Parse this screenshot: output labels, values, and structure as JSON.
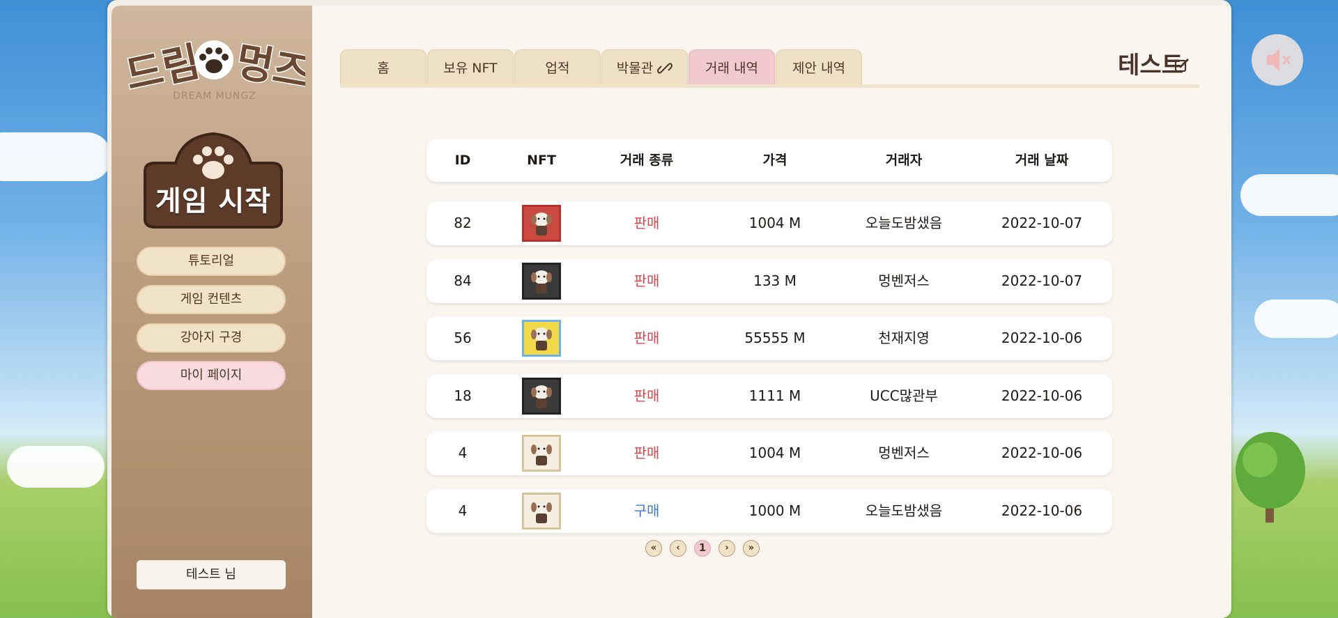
{
  "sidebar": {
    "logo_text": "드림멍즈",
    "logo_sub": "DREAM MUNGZ",
    "start_button": "게임 시작",
    "nav": [
      {
        "label": "튜토리얼"
      },
      {
        "label": "게임 컨텐츠"
      },
      {
        "label": "강아지 구경"
      },
      {
        "label": "마이 페이지"
      }
    ],
    "user_label": "테스트 님"
  },
  "tabs": [
    {
      "label": "홈"
    },
    {
      "label": "보유 NFT"
    },
    {
      "label": "업적"
    },
    {
      "label": "박물관"
    },
    {
      "label": "거래 내역"
    },
    {
      "label": "제안 내역"
    }
  ],
  "profile": {
    "name": "테스트"
  },
  "table": {
    "headers": [
      "ID",
      "NFT",
      "거래 종류",
      "가격",
      "거래자",
      "거래 날짜"
    ],
    "rows": [
      {
        "id": "82",
        "type": "판매",
        "price": "1004 M",
        "trader": "오늘도밤샜음",
        "date": "2022-10-07",
        "nft_frame": "#b8322b",
        "nft_bg": "#c8493d"
      },
      {
        "id": "84",
        "type": "판매",
        "price": "133 M",
        "trader": "멍벤저스",
        "date": "2022-10-07",
        "nft_frame": "#222222",
        "nft_bg": "#3a3a3a"
      },
      {
        "id": "56",
        "type": "판매",
        "price": "55555 M",
        "trader": "천재지영",
        "date": "2022-10-06",
        "nft_frame": "#6fb4e8",
        "nft_bg": "#f1d94a"
      },
      {
        "id": "18",
        "type": "판매",
        "price": "1111 M",
        "trader": "UCC많관부",
        "date": "2022-10-06",
        "nft_frame": "#222222",
        "nft_bg": "#3a3a3a"
      },
      {
        "id": "4",
        "type": "판매",
        "price": "1004 M",
        "trader": "멍벤저스",
        "date": "2022-10-06",
        "nft_frame": "#d8c39e",
        "nft_bg": "#f6efe0"
      },
      {
        "id": "4",
        "type": "구매",
        "price": "1000 M",
        "trader": "오늘도밤샜음",
        "date": "2022-10-06",
        "nft_frame": "#d8c39e",
        "nft_bg": "#f6efe0"
      }
    ]
  },
  "pagination": {
    "first": "«",
    "prev": "‹",
    "current": "1",
    "next": "›",
    "last": "»"
  },
  "colors": {
    "sell": "#e0454d",
    "buy": "#3b79d4",
    "active_tab": "#f1c9cf",
    "brand_brown": "#5a3a26"
  }
}
